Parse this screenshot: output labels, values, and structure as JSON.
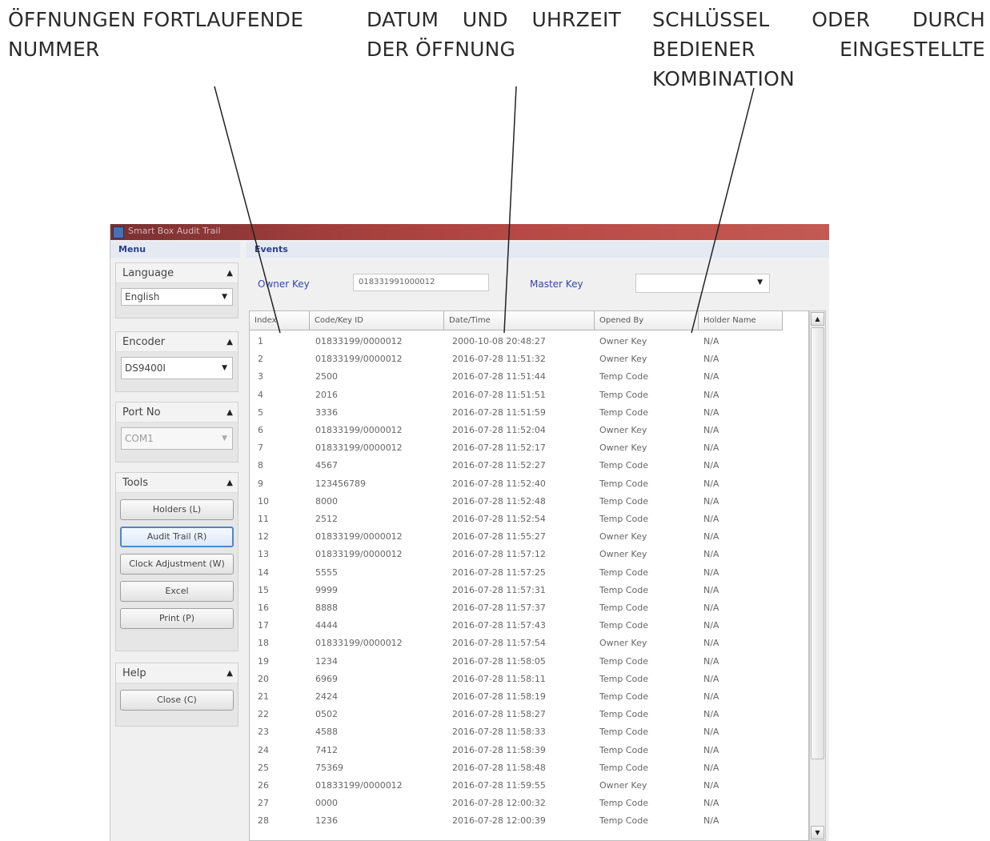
{
  "annotations": {
    "index_label": [
      "ÖFFNUNGEN FORTLAUFENDE",
      "NUMMER"
    ],
    "datetime_label": [
      "DATUM UND UHRZEIT",
      "DER ÖFFNUNG"
    ],
    "opened_by_label": [
      "SCHLÜSSEL ODER DURCH",
      "BEDIENER EINGESTELLTE",
      "KOMBINATION"
    ]
  },
  "window": {
    "title": "Smart Box Audit Trail"
  },
  "sidebar": {
    "header": "Menu",
    "language": {
      "title": "Language",
      "value": "English"
    },
    "encoder": {
      "title": "Encoder",
      "value": "DS9400I"
    },
    "port": {
      "title": "Port No",
      "value": "COM1"
    },
    "tools": {
      "title": "Tools",
      "buttons": [
        "Holders (L)",
        "Audit Trail (R)",
        "Clock Adjustment (W)",
        "Excel",
        "Print (P)"
      ]
    },
    "help": {
      "title": "Help",
      "close_label": "Close (C)"
    }
  },
  "events": {
    "header": "Events",
    "owner_key_label": "Owner Key",
    "owner_key_value": "018331991000012",
    "master_key_label": "Master Key",
    "master_key_value": ""
  },
  "table": {
    "columns": [
      "Index",
      "Code/Key ID",
      "Date/Time",
      "Opened By",
      "Holder Name"
    ],
    "rows": [
      [
        "1",
        "01833199/0000012",
        "2000-10-08 20:48:27",
        "Owner Key",
        "N/A"
      ],
      [
        "2",
        "01833199/0000012",
        "2016-07-28 11:51:32",
        "Owner Key",
        "N/A"
      ],
      [
        "3",
        "2500",
        "2016-07-28 11:51:44",
        "Temp Code",
        "N/A"
      ],
      [
        "4",
        "2016",
        "2016-07-28 11:51:51",
        "Temp Code",
        "N/A"
      ],
      [
        "5",
        "3336",
        "2016-07-28 11:51:59",
        "Temp Code",
        "N/A"
      ],
      [
        "6",
        "01833199/0000012",
        "2016-07-28 11:52:04",
        "Owner Key",
        "N/A"
      ],
      [
        "7",
        "01833199/0000012",
        "2016-07-28 11:52:17",
        "Owner Key",
        "N/A"
      ],
      [
        "8",
        "4567",
        "2016-07-28 11:52:27",
        "Temp Code",
        "N/A"
      ],
      [
        "9",
        "123456789",
        "2016-07-28 11:52:40",
        "Temp Code",
        "N/A"
      ],
      [
        "10",
        "8000",
        "2016-07-28 11:52:48",
        "Temp Code",
        "N/A"
      ],
      [
        "11",
        "2512",
        "2016-07-28 11:52:54",
        "Temp Code",
        "N/A"
      ],
      [
        "12",
        "01833199/0000012",
        "2016-07-28 11:55:27",
        "Owner Key",
        "N/A"
      ],
      [
        "13",
        "01833199/0000012",
        "2016-07-28 11:57:12",
        "Owner Key",
        "N/A"
      ],
      [
        "14",
        "5555",
        "2016-07-28 11:57:25",
        "Temp Code",
        "N/A"
      ],
      [
        "15",
        "9999",
        "2016-07-28 11:57:31",
        "Temp Code",
        "N/A"
      ],
      [
        "16",
        "8888",
        "2016-07-28 11:57:37",
        "Temp Code",
        "N/A"
      ],
      [
        "17",
        "4444",
        "2016-07-28 11:57:43",
        "Temp Code",
        "N/A"
      ],
      [
        "18",
        "01833199/0000012",
        "2016-07-28 11:57:54",
        "Owner Key",
        "N/A"
      ],
      [
        "19",
        "1234",
        "2016-07-28 11:58:05",
        "Temp Code",
        "N/A"
      ],
      [
        "20",
        "6969",
        "2016-07-28 11:58:11",
        "Temp Code",
        "N/A"
      ],
      [
        "21",
        "2424",
        "2016-07-28 11:58:19",
        "Temp Code",
        "N/A"
      ],
      [
        "22",
        "0502",
        "2016-07-28 11:58:27",
        "Temp Code",
        "N/A"
      ],
      [
        "23",
        "4588",
        "2016-07-28 11:58:33",
        "Temp Code",
        "N/A"
      ],
      [
        "24",
        "7412",
        "2016-07-28 11:58:39",
        "Temp Code",
        "N/A"
      ],
      [
        "25",
        "75369",
        "2016-07-28 11:58:48",
        "Temp Code",
        "N/A"
      ],
      [
        "26",
        "01833199/0000012",
        "2016-07-28 11:59:55",
        "Owner Key",
        "N/A"
      ],
      [
        "27",
        "0000",
        "2016-07-28 12:00:32",
        "Temp Code",
        "N/A"
      ],
      [
        "28",
        "1236",
        "2016-07-28 12:00:39",
        "Temp Code",
        "N/A"
      ]
    ]
  },
  "icons": {
    "dropdown": "chevron-down-icon",
    "collapse": "chevron-up-icon",
    "scroll_up": "scroll-up-arrow-icon",
    "scroll_down": "scroll-down-arrow-icon"
  },
  "colors": {
    "titlebar": "#a13e3c",
    "label_blue": "#3446a8",
    "focus_blue": "#4e88c9"
  }
}
